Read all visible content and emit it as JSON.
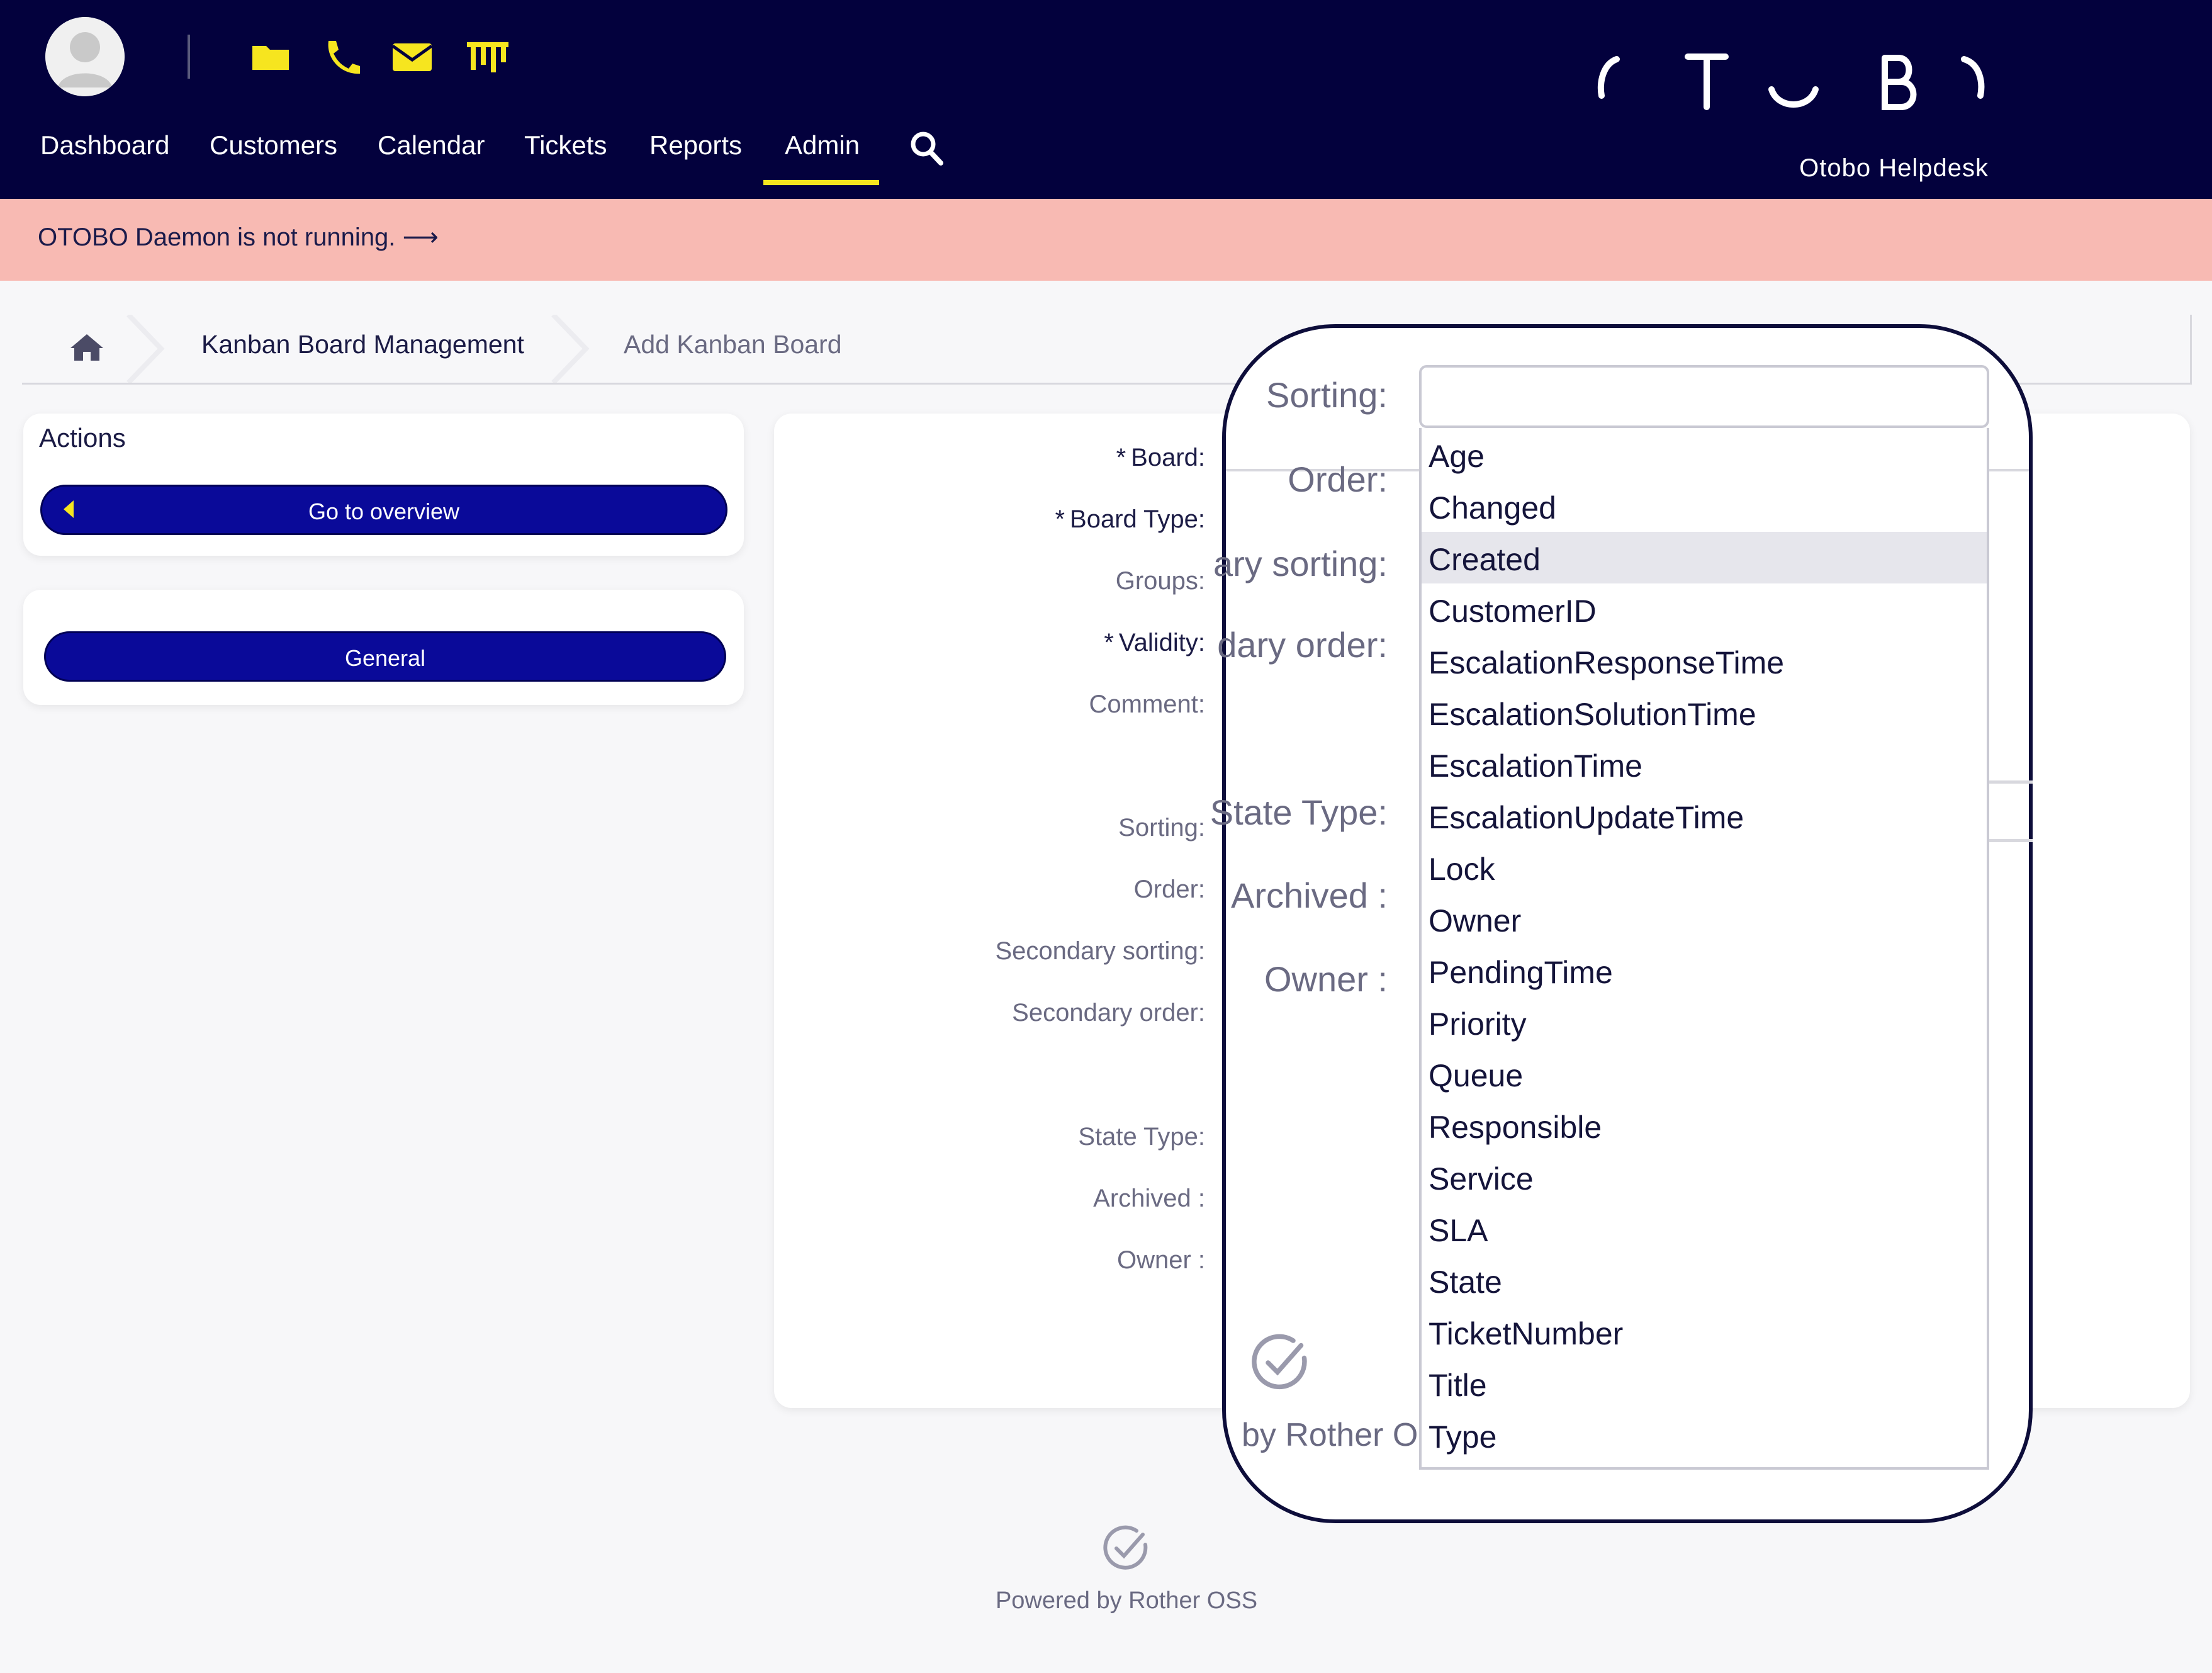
{
  "header": {
    "nav": [
      "Dashboard",
      "Customers",
      "Calendar",
      "Tickets",
      "Reports",
      "Admin"
    ],
    "active_nav": "Admin",
    "brand": "Otobo Helpdesk",
    "icons": [
      "avatar-icon",
      "folder-icon",
      "phone-icon",
      "mail-icon",
      "kanban-icon",
      "search-icon"
    ],
    "accent_color": "#f6e51f",
    "bg_color": "#03013d"
  },
  "notice": {
    "text": "OTOBO Daemon is not running. ⟶",
    "bg_color": "#f8bab3"
  },
  "breadcrumb": {
    "items": [
      "Kanban Board Management",
      "Add Kanban Board"
    ]
  },
  "sidebar": {
    "actions_title": "Actions",
    "overview_button": "Go to overview",
    "general_button": "General"
  },
  "form": {
    "labels": {
      "board": "Board:",
      "board_type": "Board Type:",
      "groups": "Groups:",
      "validity": "Validity:",
      "comment": "Comment:",
      "sorting": "Sorting:",
      "order": "Order:",
      "secondary_sorting": "Secondary sorting:",
      "secondary_order": "Secondary order:",
      "state_type": "State Type:",
      "archived": "Archived :",
      "owner": "Owner :"
    },
    "required_mark": "*"
  },
  "footer": {
    "text": "Powered by Rother OSS"
  },
  "zoom": {
    "labels": {
      "sorting": "Sorting:",
      "order": "Order:",
      "secondary_sorting": "ary sorting:",
      "secondary_order": "dary order:",
      "state_type": "State Type:",
      "archived": "Archived :",
      "owner": "Owner :"
    },
    "footer_text": "by Rother O",
    "sorting_value": "",
    "highlighted_option": "Created",
    "options": [
      "Age",
      "Changed",
      "Created",
      "CustomerID",
      "EscalationResponseTime",
      "EscalationSolutionTime",
      "EscalationTime",
      "EscalationUpdateTime",
      "Lock",
      "Owner",
      "PendingTime",
      "Priority",
      "Queue",
      "Responsible",
      "Service",
      "SLA",
      "State",
      "TicketNumber",
      "Title",
      "Type"
    ]
  }
}
